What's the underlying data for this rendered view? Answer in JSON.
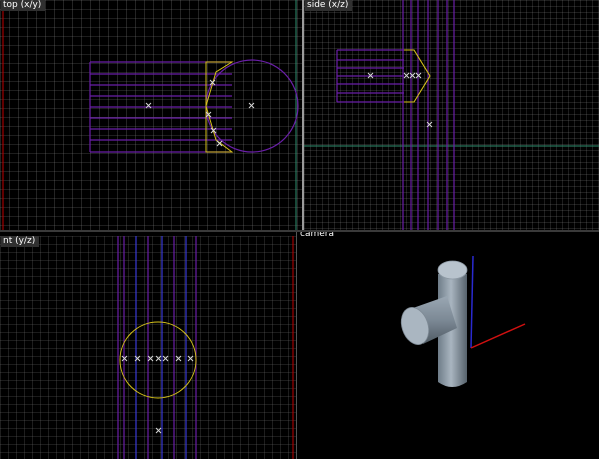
{
  "viewports": {
    "top": {
      "label": "top (x/y)"
    },
    "side": {
      "label": "side (x/z)"
    },
    "front": {
      "label": "nt (y/z)"
    },
    "camera": {
      "label": "camera"
    }
  },
  "colors": {
    "grid_minor": "#8c8c8c",
    "grid_major": "#e6e6e6",
    "axis_green": "#2f8f6f",
    "axis_red": "#c00000",
    "wire_purple": "#6a1fa8",
    "wire_blue": "#3a3ad6",
    "wire_yellow": "#d6c21a",
    "vertex_marker": "#d8d8d8",
    "cylinder_shade": "#8a98a6",
    "camera_axis_blue": "#2a2ad0",
    "camera_axis_red": "#d01010"
  }
}
